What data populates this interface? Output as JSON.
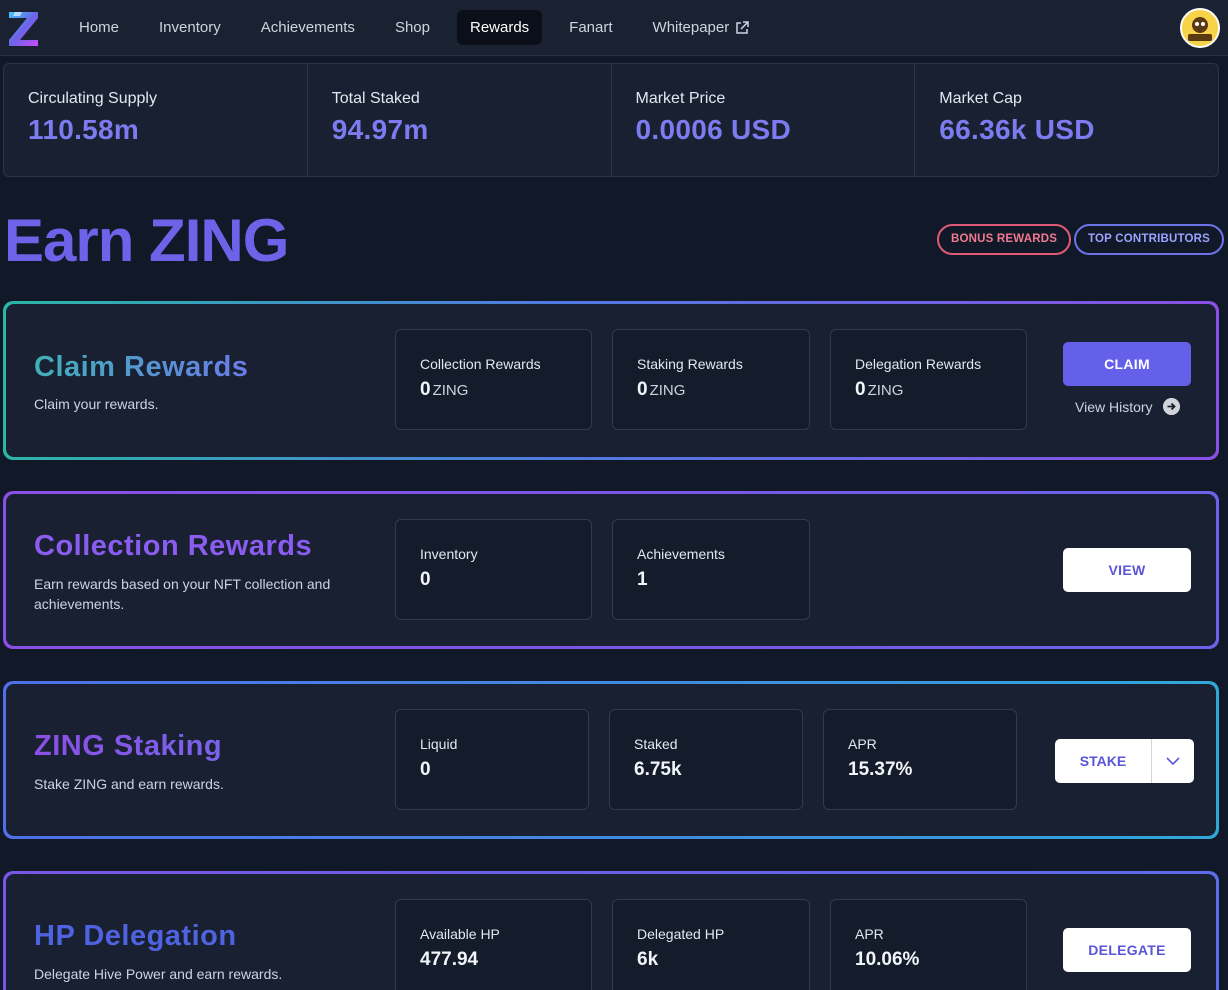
{
  "nav": {
    "items": [
      {
        "label": "Home"
      },
      {
        "label": "Inventory"
      },
      {
        "label": "Achievements"
      },
      {
        "label": "Shop"
      },
      {
        "label": "Rewards",
        "active": true
      },
      {
        "label": "Fanart"
      },
      {
        "label": "Whitepaper",
        "icon": "external-link-icon"
      }
    ],
    "logo_icon": "zing-logo-icon",
    "avatar_icon": "user-avatar-icon"
  },
  "stats": [
    {
      "label": "Circulating Supply",
      "value": "110.58m"
    },
    {
      "label": "Total Staked",
      "value": "94.97m"
    },
    {
      "label": "Market Price",
      "value": "0.0006 USD"
    },
    {
      "label": "Market Cap",
      "value": "66.36k USD"
    }
  ],
  "header": {
    "title": "Earn ZING",
    "bonus_label": "BONUS REWARDS",
    "top_label": "TOP CONTRIBUTORS"
  },
  "claim": {
    "title": "Claim Rewards",
    "desc": "Claim your rewards.",
    "boxes": [
      {
        "label": "Collection Rewards",
        "value": "0",
        "unit": "ZING"
      },
      {
        "label": "Staking Rewards",
        "value": "0",
        "unit": "ZING"
      },
      {
        "label": "Delegation Rewards",
        "value": "0",
        "unit": "ZING"
      }
    ],
    "button": "CLAIM",
    "history": "View History"
  },
  "collection": {
    "title": "Collection Rewards",
    "desc": "Earn rewards based on your NFT collection and achievements.",
    "boxes": [
      {
        "label": "Inventory",
        "value": "0"
      },
      {
        "label": "Achievements",
        "value": "1"
      }
    ],
    "button": "VIEW"
  },
  "staking": {
    "title": "ZING Staking",
    "desc": "Stake ZING and earn rewards.",
    "boxes": [
      {
        "label": "Liquid",
        "value": "0"
      },
      {
        "label": "Staked",
        "value": "6.75k"
      },
      {
        "label": "APR",
        "value": "15.37%"
      }
    ],
    "button": "STAKE"
  },
  "delegation": {
    "title": "HP Delegation",
    "desc": "Delegate Hive Power and earn rewards.",
    "boxes": [
      {
        "label": "Available HP",
        "value": "477.94"
      },
      {
        "label": "Delegated HP",
        "value": "6k"
      },
      {
        "label": "APR",
        "value": "10.06%"
      }
    ],
    "button": "DELEGATE"
  },
  "colors": {
    "accent": "#6560ea",
    "background": "#111827",
    "bonus": "#e05a78"
  }
}
